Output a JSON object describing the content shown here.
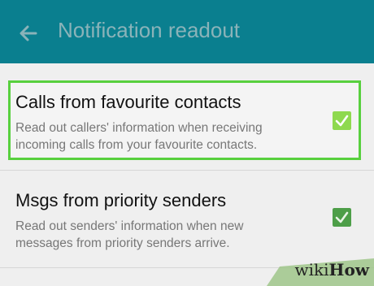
{
  "header": {
    "title": "Notification readout",
    "background": "#0a7f8f",
    "back_icon": "arrow-left-icon"
  },
  "items": [
    {
      "title": "Calls from favourite contacts",
      "description_line1": "Read out callers' information when receiving",
      "description_line2": "incoming calls from your favourite contacts.",
      "checked": true,
      "check_color": "#8ed94f"
    },
    {
      "title": "Msgs from priority senders",
      "description_line1": "Read out senders' information when new",
      "description_line2": "messages from priority senders arrive.",
      "checked": true,
      "check_color": "#4d9e48"
    }
  ],
  "highlight_color": "#58d03e",
  "watermark": {
    "wiki": "wiki",
    "how": "How"
  }
}
